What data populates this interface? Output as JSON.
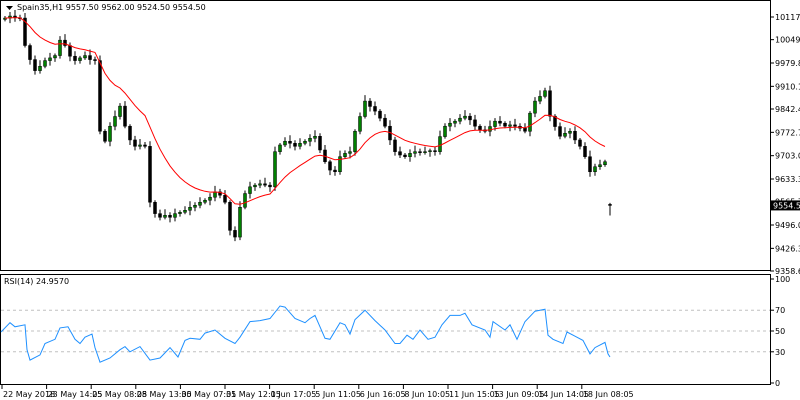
{
  "header": {
    "symbol_info": "Spain35,H1  9557.50 9562.00 9524.50 9554.50",
    "menu_icon": "triangle-down-icon"
  },
  "colors": {
    "bull": "#008000",
    "bear": "#000000",
    "ma": "#ff0000",
    "rsi": "#1e90ff",
    "price_tag_bg": "#000000",
    "price_tag_fg": "#ffffff"
  },
  "chart_data": [
    {
      "type": "candlestick",
      "title": "Spain35,H1",
      "ohlc_last": {
        "open": 9557.5,
        "high": 9562.0,
        "low": 9524.5,
        "close": 9554.5
      },
      "price_axis_ticks": [
        "10117.15",
        "10049.50",
        "9979.80",
        "9910.10",
        "9842.45",
        "9772.75",
        "9703.05",
        "9633.35",
        "9565.70",
        "9496.00",
        "9426.30",
        "9358.65"
      ],
      "ylim": [
        9358.65,
        10117.15
      ],
      "current_price_label": "9554.50",
      "closes": [
        10114,
        10120,
        10115,
        10114,
        10032,
        9990,
        9957,
        9970,
        9987,
        9995,
        10002,
        10048,
        10032,
        10000,
        9987,
        9995,
        10002,
        9990,
        9987,
        9776,
        9746,
        9791,
        9820,
        9851,
        9791,
        9750,
        9731,
        9735,
        9731,
        9564,
        9530,
        9519,
        9525,
        9519,
        9530,
        9534,
        9540,
        9549,
        9555,
        9564,
        9570,
        9579,
        9595,
        9585,
        9564,
        9480,
        9460,
        9549,
        9590,
        9610,
        9615,
        9619,
        9615,
        9610,
        9715,
        9735,
        9746,
        9740,
        9731,
        9740,
        9746,
        9755,
        9761,
        9720,
        9685,
        9660,
        9655,
        9700,
        9710,
        9715,
        9776,
        9820,
        9866,
        9850,
        9836,
        9815,
        9791,
        9750,
        9715,
        9705,
        9700,
        9710,
        9715,
        9712,
        9715,
        9718,
        9715,
        9760,
        9791,
        9800,
        9806,
        9815,
        9821,
        9810,
        9791,
        9780,
        9776,
        9790,
        9806,
        9800,
        9791,
        9795,
        9791,
        9785,
        9776,
        9830,
        9866,
        9880,
        9897,
        9821,
        9790,
        9761,
        9770,
        9776,
        9750,
        9731,
        9700,
        9655,
        9670,
        9676,
        9685,
        9554.5
      ],
      "moving_average": {
        "color": "#ff0000"
      },
      "time_labels": [
        "22 May 2018",
        "23 May 14:05",
        "25 May 08:05",
        "28 May 13:05",
        "30 May 07:05",
        "31 May 12:05",
        "1 Jun 17:05",
        "5 Jun 11:05",
        "6 Jun 16:05",
        "8 Jun 10:05",
        "11 Jun 15:05",
        "13 Jun 09:05",
        "14 Jun 14:05",
        "18 Jun 08:05"
      ]
    },
    {
      "type": "line",
      "title": "RSI(14) 24.9570",
      "ylim": [
        0,
        100
      ],
      "ticks": [
        "100",
        "70",
        "50",
        "30",
        "0"
      ],
      "levels": [
        70,
        50,
        30
      ],
      "points": [
        [
          -1,
          49
        ],
        [
          1,
          58
        ],
        [
          2,
          54
        ],
        [
          4,
          56
        ],
        [
          4.4,
          32
        ],
        [
          5,
          22
        ],
        [
          7,
          27
        ],
        [
          8,
          38
        ],
        [
          10,
          42
        ],
        [
          11,
          53
        ],
        [
          12.6,
          54
        ],
        [
          14,
          42
        ],
        [
          15,
          38
        ],
        [
          16,
          44
        ],
        [
          17.4,
          47
        ],
        [
          18,
          34
        ],
        [
          19,
          20
        ],
        [
          21,
          24
        ],
        [
          23,
          32
        ],
        [
          24,
          35
        ],
        [
          25,
          30
        ],
        [
          27,
          35
        ],
        [
          29,
          22
        ],
        [
          31,
          24
        ],
        [
          33,
          34
        ],
        [
          34.6,
          25
        ],
        [
          36,
          41
        ],
        [
          37,
          43
        ],
        [
          39,
          42
        ],
        [
          40,
          48
        ],
        [
          42,
          51
        ],
        [
          44,
          43
        ],
        [
          46,
          38
        ],
        [
          47,
          44
        ],
        [
          49,
          59
        ],
        [
          51,
          60
        ],
        [
          53,
          62
        ],
        [
          55,
          74
        ],
        [
          56,
          73
        ],
        [
          58,
          62
        ],
        [
          60,
          58
        ],
        [
          61,
          62
        ],
        [
          62,
          65
        ],
        [
          63,
          54
        ],
        [
          64,
          43
        ],
        [
          65,
          42
        ],
        [
          67,
          58
        ],
        [
          68,
          56
        ],
        [
          69,
          47
        ],
        [
          70,
          61
        ],
        [
          72,
          70
        ],
        [
          74,
          60
        ],
        [
          76,
          51
        ],
        [
          78,
          38
        ],
        [
          79,
          38
        ],
        [
          80.4,
          46
        ],
        [
          81.6,
          42
        ],
        [
          83,
          51
        ],
        [
          84.6,
          42
        ],
        [
          86,
          44
        ],
        [
          87.4,
          56
        ],
        [
          89,
          65
        ],
        [
          91,
          65
        ],
        [
          92,
          67
        ],
        [
          93.4,
          56
        ],
        [
          96,
          51
        ],
        [
          97,
          44
        ],
        [
          97.6,
          59
        ],
        [
          100,
          51
        ],
        [
          101,
          56
        ],
        [
          102.4,
          42
        ],
        [
          104,
          59
        ],
        [
          106,
          69
        ],
        [
          108,
          71
        ],
        [
          108.6,
          46
        ],
        [
          109.6,
          42
        ],
        [
          111.6,
          38
        ],
        [
          112.4,
          49
        ],
        [
          114,
          45
        ],
        [
          115.6,
          41
        ],
        [
          117,
          28
        ],
        [
          118,
          34
        ],
        [
          120,
          39
        ],
        [
          120.6,
          28
        ],
        [
          121,
          24.96
        ]
      ]
    }
  ]
}
